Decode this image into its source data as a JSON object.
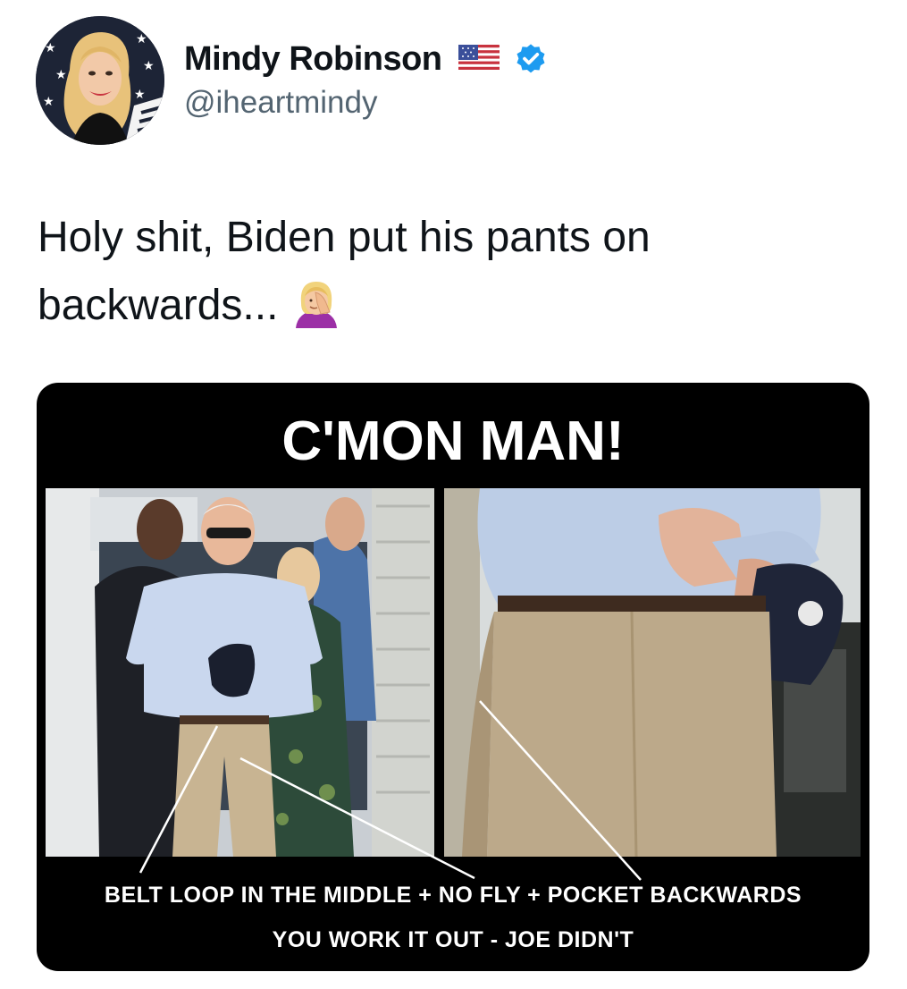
{
  "author": {
    "name": "Mindy Robinson",
    "handle": "@iheartmindy",
    "flag_icon": "us-flag-emoji",
    "verified_icon": "verified-badge-icon",
    "verified_color": "#1d9bf0"
  },
  "tweet": {
    "text": "Holy shit, Biden put his pants on backwards...",
    "emoji": "woman-facepalming-emoji"
  },
  "media": {
    "title": "C'MON MAN!",
    "caption_line1": "BELT LOOP IN THE MIDDLE + NO FLY + POCKET BACKWARDS",
    "caption_line2": "YOU WORK IT OUT - JOE DIDN'T"
  }
}
